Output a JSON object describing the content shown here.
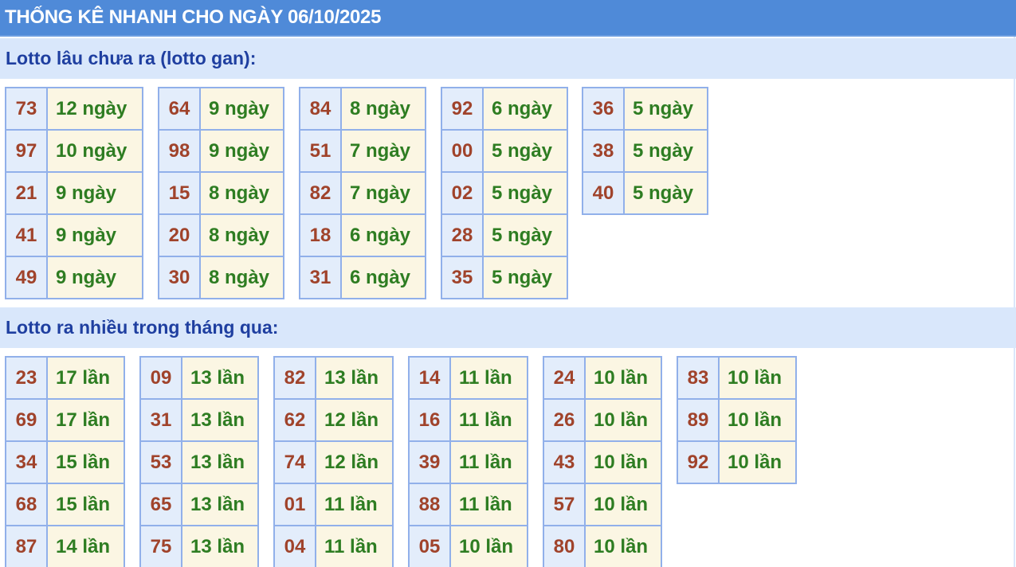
{
  "header": {
    "title": "THỐNG KÊ NHANH CHO NGÀY 06/10/2025"
  },
  "gan_section": {
    "title": "Lotto lâu chưa ra (lotto gan):",
    "groups": [
      [
        {
          "num": "73",
          "val": "12 ngày"
        },
        {
          "num": "97",
          "val": "10 ngày"
        },
        {
          "num": "21",
          "val": "9 ngày"
        },
        {
          "num": "41",
          "val": "9 ngày"
        },
        {
          "num": "49",
          "val": "9 ngày"
        }
      ],
      [
        {
          "num": "64",
          "val": "9 ngày"
        },
        {
          "num": "98",
          "val": "9 ngày"
        },
        {
          "num": "15",
          "val": "8 ngày"
        },
        {
          "num": "20",
          "val": "8 ngày"
        },
        {
          "num": "30",
          "val": "8 ngày"
        }
      ],
      [
        {
          "num": "84",
          "val": "8 ngày"
        },
        {
          "num": "51",
          "val": "7 ngày"
        },
        {
          "num": "82",
          "val": "7 ngày"
        },
        {
          "num": "18",
          "val": "6 ngày"
        },
        {
          "num": "31",
          "val": "6 ngày"
        }
      ],
      [
        {
          "num": "92",
          "val": "6 ngày"
        },
        {
          "num": "00",
          "val": "5 ngày"
        },
        {
          "num": "02",
          "val": "5 ngày"
        },
        {
          "num": "28",
          "val": "5 ngày"
        },
        {
          "num": "35",
          "val": "5 ngày"
        }
      ],
      [
        {
          "num": "36",
          "val": "5 ngày"
        },
        {
          "num": "38",
          "val": "5 ngày"
        },
        {
          "num": "40",
          "val": "5 ngày"
        }
      ]
    ]
  },
  "frequent_section": {
    "title": "Lotto ra nhiều trong tháng qua:",
    "groups": [
      [
        {
          "num": "23",
          "val": "17 lần"
        },
        {
          "num": "69",
          "val": "17 lần"
        },
        {
          "num": "34",
          "val": "15 lần"
        },
        {
          "num": "68",
          "val": "15 lần"
        },
        {
          "num": "87",
          "val": "14 lần"
        }
      ],
      [
        {
          "num": "09",
          "val": "13 lần"
        },
        {
          "num": "31",
          "val": "13 lần"
        },
        {
          "num": "53",
          "val": "13 lần"
        },
        {
          "num": "65",
          "val": "13 lần"
        },
        {
          "num": "75",
          "val": "13 lần"
        }
      ],
      [
        {
          "num": "82",
          "val": "13 lần"
        },
        {
          "num": "62",
          "val": "12 lần"
        },
        {
          "num": "74",
          "val": "12 lần"
        },
        {
          "num": "01",
          "val": "11 lần"
        },
        {
          "num": "04",
          "val": "11 lần"
        }
      ],
      [
        {
          "num": "14",
          "val": "11 lần"
        },
        {
          "num": "16",
          "val": "11 lần"
        },
        {
          "num": "39",
          "val": "11 lần"
        },
        {
          "num": "88",
          "val": "11 lần"
        },
        {
          "num": "05",
          "val": "10 lần"
        }
      ],
      [
        {
          "num": "24",
          "val": "10 lần"
        },
        {
          "num": "26",
          "val": "10 lần"
        },
        {
          "num": "43",
          "val": "10 lần"
        },
        {
          "num": "57",
          "val": "10 lần"
        },
        {
          "num": "80",
          "val": "10 lần"
        }
      ],
      [
        {
          "num": "83",
          "val": "10 lần"
        },
        {
          "num": "89",
          "val": "10 lần"
        },
        {
          "num": "92",
          "val": "10 lần"
        }
      ]
    ]
  }
}
